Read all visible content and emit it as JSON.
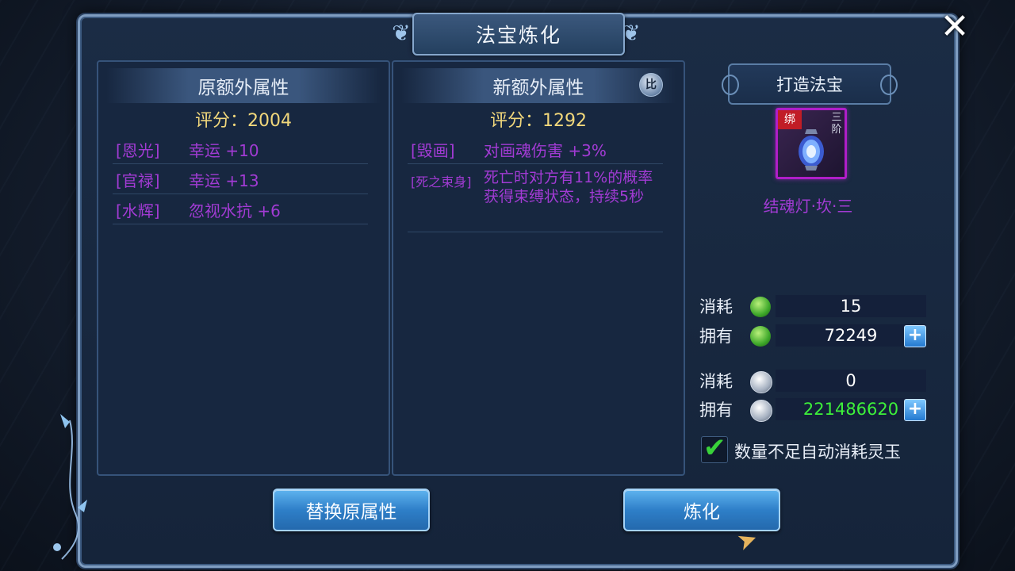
{
  "window": {
    "title": "法宝炼化"
  },
  "left_panel": {
    "header": "原额外属性",
    "score_label": "评分：",
    "score_value": "2004",
    "attributes": [
      {
        "tag": "[恩光]",
        "effect": "幸运 +10"
      },
      {
        "tag": "[官禄]",
        "effect": "幸运 +13"
      },
      {
        "tag": "[水辉]",
        "effect": "忽视水抗 +6"
      }
    ]
  },
  "mid_panel": {
    "header": "新额外属性",
    "compare_label": "比",
    "score_label": "评分：",
    "score_value": "1292",
    "attributes": [
      {
        "tag": "[毁画]",
        "effect": "对画魂伤害 +3%"
      },
      {
        "tag": "[死之束身]",
        "effect": "死亡时对方有11%的概率获得束缚状态，持续5秒"
      }
    ]
  },
  "right_panel": {
    "craft_title": "打造法宝",
    "item": {
      "name": "结魂灯·坎·三",
      "bind_label": "绑",
      "tier_label": "三阶",
      "icon": "lantern-icon"
    },
    "jade_cost_label": "消耗",
    "jade_cost_value": "15",
    "jade_own_label": "拥有",
    "jade_own_value": "72249",
    "silver_cost_label": "消耗",
    "silver_cost_value": "0",
    "silver_own_label": "拥有",
    "silver_own_value": "221486620",
    "auto_consume_label": "数量不足自动消耗灵玉",
    "auto_consume_checked": true
  },
  "buttons": {
    "replace_label": "替换原属性",
    "refine_label": "炼化"
  },
  "colors": {
    "attr_purple": "#a23bd4",
    "score_gold": "#f1d77b",
    "money_green": "#3df03a",
    "button_blue": "#2e7fc8"
  }
}
